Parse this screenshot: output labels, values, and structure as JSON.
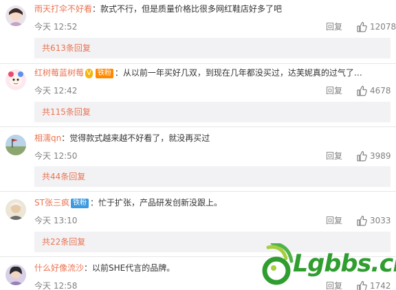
{
  "comments": [
    {
      "username": "雨天打伞不好看",
      "text": "：款式不行，但是质量价格比很多网红鞋店好多了吧",
      "time": "今天 12:52",
      "reply_label": "回复",
      "likes": "12078",
      "more_replies": "共613条回复",
      "avatar_icon": "avatar-icon"
    },
    {
      "username": "红树莓蓝树莓",
      "badge_vip": "V",
      "badge": "铁粉",
      "text": "：从以前一年买好几双，到现在几年都没买过，达芙妮真的过气了…",
      "time": "今天 12:42",
      "reply_label": "回复",
      "likes": "4678",
      "more_replies": "共115条回复"
    },
    {
      "username": "相濡qn",
      "text": "：觉得款式越来越不好看了，就没再买过",
      "time": "今天 12:50",
      "reply_label": "回复",
      "likes": "3989",
      "more_replies": "共44条回复"
    },
    {
      "username": "ST张三疯",
      "badge": "铁粉",
      "text": "：忙于扩张，产品研发创新没跟上。",
      "time": "今天 13:10",
      "reply_label": "回复",
      "likes": "3033",
      "more_replies": "共22条回复"
    },
    {
      "username": "什么好像流沙",
      "text": "：以前SHE代言的品牌。",
      "time": "今天 12:58",
      "reply_label": "回复",
      "likes": "1742"
    }
  ],
  "watermark": {
    "text": "Lgbbs.cn",
    "icon": "lgbbs-logo-icon"
  },
  "colors": {
    "username": "#eb7350",
    "meta": "#808080",
    "more_bg": "#f2f2f5",
    "badge": "#3c9ae0"
  }
}
